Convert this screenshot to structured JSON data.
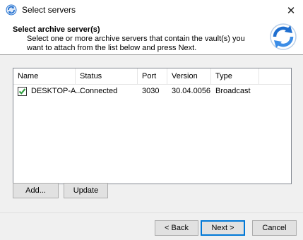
{
  "window": {
    "title": "Select servers",
    "close_glyph": "✕"
  },
  "header": {
    "title": "Select archive server(s)",
    "description": "Select one or more archive servers that contain the vault(s) you want to attach from the list below and press Next."
  },
  "list": {
    "columns": [
      "Name",
      "Status",
      "Port",
      "Version",
      "Type"
    ],
    "rows": [
      {
        "checked": true,
        "name": "DESKTOP-A...",
        "status": "Connected",
        "port": "3030",
        "version": "30.04.0056",
        "type": "Broadcast"
      }
    ]
  },
  "buttons": {
    "add": "Add...",
    "update": "Update",
    "back": "< Back",
    "next": "Next >",
    "cancel": "Cancel"
  },
  "colors": {
    "check": "#2e9e3e",
    "accent": "#0078d7",
    "icon_blue": "#1f6fd0"
  },
  "icons": {
    "app": "refresh-arrows-icon",
    "header": "sync-arrows-icon",
    "close": "close-icon"
  }
}
